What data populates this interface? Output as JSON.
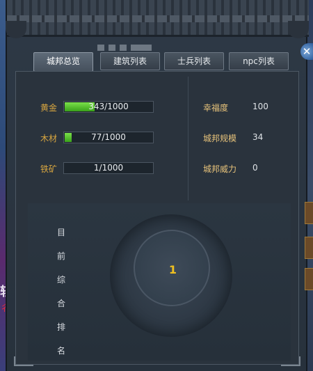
{
  "side": {
    "text_top": "轻",
    "text_bottom": "彳"
  },
  "window": {
    "close_label": "✕"
  },
  "tabs": [
    {
      "label": "城邦总览",
      "active": true
    },
    {
      "label": "建筑列表",
      "active": false
    },
    {
      "label": "士兵列表",
      "active": false
    },
    {
      "label": "npc列表",
      "active": false
    }
  ],
  "resources": [
    {
      "label": "黄金",
      "value_text": "343/1000",
      "fill": 0.343
    },
    {
      "label": "木材",
      "value_text": "77/1000",
      "fill": 0.077
    },
    {
      "label": "铁矿",
      "value_text": "1/1000",
      "fill": 0.001
    }
  ],
  "stats": [
    {
      "label": "幸福度",
      "value": "100"
    },
    {
      "label": "城邦规模",
      "value": "34"
    },
    {
      "label": "城邦威力",
      "value": "0"
    }
  ],
  "ranking": {
    "label_chars": [
      "目",
      "前",
      "综",
      "合",
      "排",
      "名"
    ],
    "value": "1"
  },
  "colors": {
    "resource_fill": "#4cc022",
    "rank_value": "#f0c020"
  }
}
